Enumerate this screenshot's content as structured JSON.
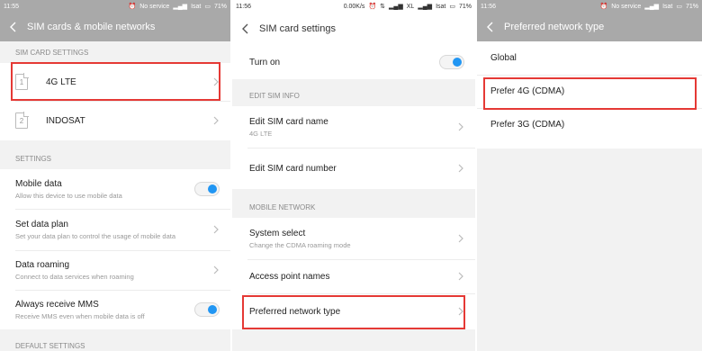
{
  "panel1": {
    "status": {
      "time": "11:55",
      "service": "No service",
      "carrier": "Isat",
      "battery": "71%"
    },
    "title": "SIM cards & mobile networks",
    "sim_section": "SIM CARD SETTINGS",
    "sims": [
      {
        "slot": "1",
        "name": "4G LTE"
      },
      {
        "slot": "2",
        "name": "INDOSAT"
      }
    ],
    "settings_section": "SETTINGS",
    "settings": [
      {
        "title": "Mobile data",
        "subtitle": "Allow this device to use mobile data",
        "control": "toggle-on"
      },
      {
        "title": "Set data plan",
        "subtitle": "Set your data plan to control the usage of mobile data",
        "control": "chevron"
      },
      {
        "title": "Data roaming",
        "subtitle": "Connect to data services when roaming",
        "control": "chevron"
      },
      {
        "title": "Always receive MMS",
        "subtitle": "Receive MMS even when mobile data is off",
        "control": "toggle-on"
      }
    ],
    "default_section": "DEFAULT SETTINGS"
  },
  "panel2": {
    "status": {
      "time": "11:56",
      "speed": "0.00K/s",
      "network": "XL",
      "carrier": "Isat",
      "battery": "71%"
    },
    "title": "SIM card settings",
    "turn_on": "Turn on",
    "edit_section": "EDIT SIM INFO",
    "edit_items": [
      {
        "title": "Edit SIM card name",
        "subtitle": "4G LTE"
      },
      {
        "title": "Edit SIM card number",
        "subtitle": ""
      }
    ],
    "mobile_section": "MOBILE NETWORK",
    "mobile_items": [
      {
        "title": "System select",
        "subtitle": "Change the CDMA roaming mode"
      },
      {
        "title": "Access point names",
        "subtitle": ""
      },
      {
        "title": "Preferred network type",
        "subtitle": ""
      }
    ]
  },
  "panel3": {
    "status": {
      "time": "11:56",
      "service": "No service",
      "carrier": "Isat",
      "battery": "71%"
    },
    "title": "Preferred network type",
    "options": [
      "Global",
      "Prefer 4G (CDMA)",
      "Prefer 3G (CDMA)"
    ]
  },
  "colors": {
    "accent": "#2196f3",
    "highlight": "#e53935",
    "header_gray": "#a9a9a9"
  }
}
